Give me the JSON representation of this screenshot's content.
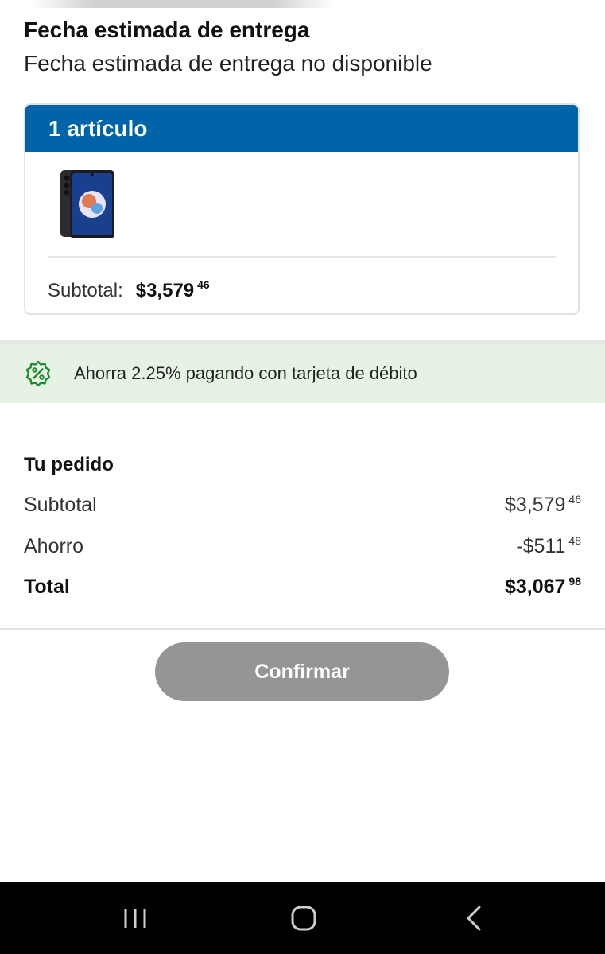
{
  "delivery": {
    "title": "Fecha estimada de entrega",
    "status": "Fecha estimada de entrega no disponible"
  },
  "items_card": {
    "header": "1 artículo",
    "product_image": "smartphone-image",
    "subtotal_label": "Subtotal:",
    "subtotal_main": "$3,579",
    "subtotal_cents": "46"
  },
  "promo": {
    "icon": "discount-badge-icon",
    "text": "Ahorra 2.25% pagando con tarjeta de débito"
  },
  "order": {
    "title": "Tu pedido",
    "rows": [
      {
        "label": "Subtotal",
        "main": "$3,579",
        "cents": "46"
      },
      {
        "label": "Ahorro",
        "main": "-$511",
        "cents": "48"
      },
      {
        "label": "Total",
        "main": "$3,067",
        "cents": "98"
      }
    ]
  },
  "actions": {
    "confirm_label": "Confirmar"
  },
  "colors": {
    "header_blue": "#0065a8",
    "promo_green_bg": "#e6f3e4",
    "promo_icon_green": "#1e8a2e",
    "button_disabled": "#959595"
  },
  "nav": {
    "recent": "recent-apps-icon",
    "home": "home-icon",
    "back": "back-icon"
  }
}
